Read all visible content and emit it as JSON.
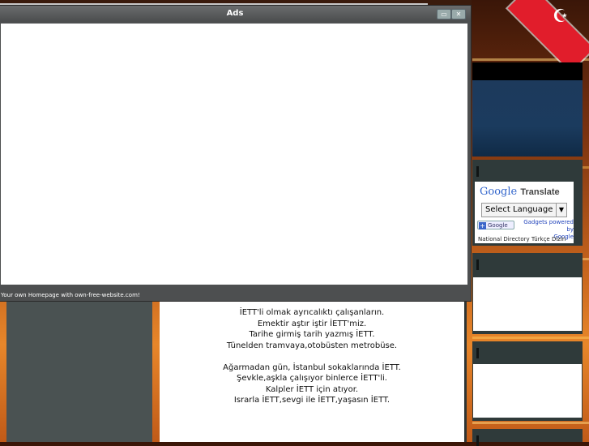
{
  "ads_window": {
    "title": "Ads",
    "footer": "Your own Homepage with own-free-website.com!",
    "minimize_icon": "minimize-icon",
    "close_icon": "close-icon"
  },
  "content": {
    "lines": [
      "İETT'li olmak ayrıcalıktı çalışanların.",
      "Emektir aştır iştir İETT'miz.",
      "Tarihe girmiş tarih yazmış İETT.",
      "Tünelden tramvaya,otobüsten metrobüse.",
      "",
      "Ağarmadan gün, İstanbul sokaklarında İETT.",
      "Şevkle,aşkla çalışıyor binlerce İETT'li.",
      "Kalpler İETT için atıyor.",
      "Israrla İETT,sevgi ile İETT,yaşasın İETT."
    ]
  },
  "translate": {
    "logo": "Google",
    "logo_suffix": "Translate",
    "select_label": "Select Language",
    "badge": "Google",
    "gadgets": "Gadgets",
    "powered": "powered by",
    "powered_google": "Google",
    "directory": "National Directory Türkçe Dizin"
  },
  "flag_symbol": "☪"
}
